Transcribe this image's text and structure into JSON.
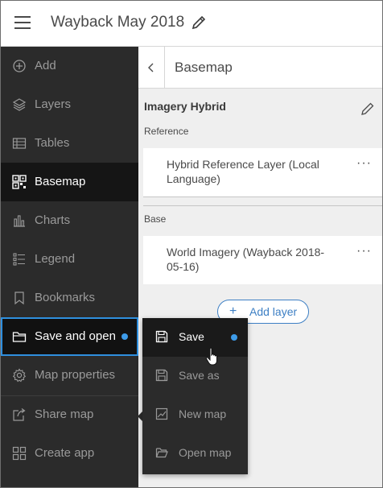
{
  "header": {
    "title": "Wayback May 2018",
    "menu_icon": "hamburger-menu-icon",
    "edit_icon": "pencil-icon"
  },
  "sidebar": {
    "items": [
      {
        "label": "Add",
        "icon": "plus-circle-icon"
      },
      {
        "label": "Layers",
        "icon": "layers-icon"
      },
      {
        "label": "Tables",
        "icon": "table-icon"
      },
      {
        "label": "Basemap",
        "icon": "basemap-grid-icon",
        "state": "active"
      },
      {
        "label": "Charts",
        "icon": "bar-chart-icon"
      },
      {
        "label": "Legend",
        "icon": "legend-list-icon"
      },
      {
        "label": "Bookmarks",
        "icon": "bookmark-icon"
      },
      {
        "label": "Save and open",
        "icon": "folder-icon",
        "state": "focused",
        "indicator": "unsaved-dot"
      },
      {
        "label": "Map properties",
        "icon": "gear-icon"
      },
      {
        "label": "Share map",
        "icon": "share-icon"
      },
      {
        "label": "Create app",
        "icon": "app-grid-icon"
      }
    ]
  },
  "panel": {
    "back_icon": "chevron-left-icon",
    "title": "Basemap",
    "basemap_name": "Imagery Hybrid",
    "edit_icon": "pencil-icon",
    "reference_label": "Reference",
    "reference_layer": "Hybrid Reference Layer (Local Language)",
    "base_label": "Base",
    "base_layer": "World Imagery (Wayback 2018-05-16)",
    "more_icon": "more-horizontal-icon",
    "more_text": "···",
    "add_layer_icon": "+",
    "add_layer_label": "Add layer"
  },
  "popup_menu": {
    "items": [
      {
        "label": "Save",
        "icon": "save-icon",
        "state": "hover",
        "indicator": "unsaved-dot"
      },
      {
        "label": "Save as",
        "icon": "save-as-icon"
      },
      {
        "label": "New map",
        "icon": "new-map-icon"
      },
      {
        "label": "Open map",
        "icon": "open-folder-icon"
      }
    ]
  },
  "colors": {
    "sidebar_bg": "#2b2b2b",
    "active_bg": "#151515",
    "accent_blue": "#2f8fde",
    "dot_blue": "#3d9be9",
    "panel_bg": "#efefef"
  }
}
